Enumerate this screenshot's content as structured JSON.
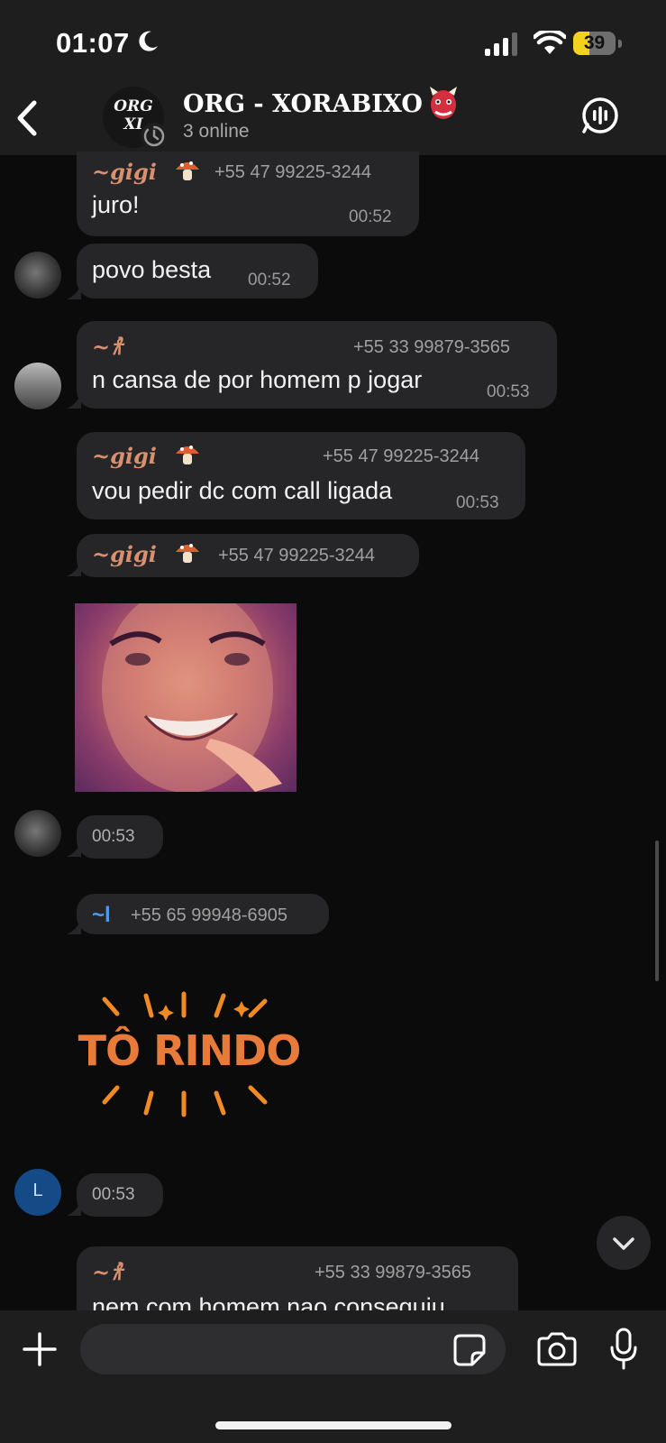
{
  "status": {
    "time": "01:07",
    "battery": "39",
    "battery_level": 0.39
  },
  "header": {
    "title": "ORG - XORABIXO",
    "subtitle": "3 online",
    "avatar_text": "ORG XI"
  },
  "messages": [
    {
      "sender": "~gigi",
      "phone": "+55 47 99225-3244",
      "text": "juro!",
      "time": "00:52"
    },
    {
      "sender": "",
      "phone": "",
      "text": "povo besta",
      "time": "00:52"
    },
    {
      "sender": "~𐀪",
      "phone": "+55 33 99879-3565",
      "text": "n cansa de por homem p jogar",
      "time": "00:53"
    },
    {
      "sender": "~gigi",
      "phone": "+55 47 99225-3244",
      "text": "vou pedir dc com call ligada",
      "time": "00:53"
    },
    {
      "sender": "~gigi",
      "phone": "+55 47 99225-3244",
      "text": "",
      "time": "00:53"
    },
    {
      "sender": "~l",
      "phone": "+55 65 99948-6905",
      "text": "",
      "time": "00:53",
      "avatar_letter": "L"
    },
    {
      "sender": "~𐀪",
      "phone": "+55 33 99879-3565",
      "text": "nem com homem nao conseguiu",
      "time": ""
    }
  ],
  "sticker": {
    "text": "TÔ RINDO"
  },
  "composer": {
    "placeholder": ""
  },
  "colors": {
    "sender_orange": "#d8906e",
    "sender_blue": "#4c9af0",
    "bubble": "#262628",
    "bar": "#1e1e1f"
  },
  "icons": [
    "moon-icon",
    "signal-icon",
    "wifi-icon",
    "battery-icon",
    "back-icon",
    "ogre-emoji",
    "voice-chat-icon",
    "mushroom-emoji",
    "scroll-down-icon",
    "plus-icon",
    "sticker-icon",
    "camera-icon",
    "mic-icon"
  ]
}
